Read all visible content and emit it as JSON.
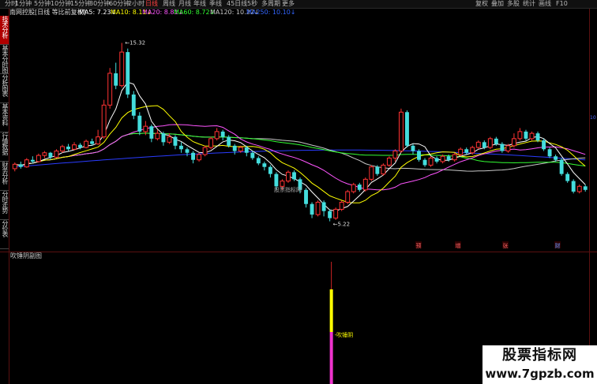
{
  "toolbar": {
    "items": [
      "分时",
      "1分钟",
      "5分钟",
      "10分钟",
      "15分钟",
      "30分钟",
      "60分钟",
      "2小时",
      "日线",
      "周线",
      "月线",
      "年线",
      "季线",
      "45日线",
      "5秒",
      "多周期",
      "更多"
    ],
    "right_items": [
      "复权",
      "叠加",
      "多股",
      "统计",
      "画线",
      "F10"
    ],
    "active": "日线"
  },
  "left_tabs": [
    "技术分析",
    "基本分时图",
    "分析图表",
    "基本资料",
    "行情数据",
    "财务分析",
    "分时走势",
    "分价表"
  ],
  "infobar": {
    "stock": "南网控股[日线 等比前复权]",
    "ma": [
      {
        "label": "MA5: 7.23",
        "color": "#ffffff",
        "arrow": "↓"
      },
      {
        "label": "MA10: 8.11",
        "color": "#ffff00",
        "arrow": "↓"
      },
      {
        "label": "MA20: 8.81",
        "color": "#ff55ff",
        "arrow": "↓"
      },
      {
        "label": "MA60: 8.72",
        "color": "#33ff33",
        "arrow": "↓"
      },
      {
        "label": "MA120: 10.22",
        "color": "#c8c8c8",
        "arrow": "↓"
      },
      {
        "label": "MA250: 10.10",
        "color": "#3366ff",
        "arrow": "↓"
      }
    ]
  },
  "subchart": {
    "title": "吹锤阴副图",
    "indicator_label": "吹锤阴"
  },
  "watermark_center": "股票指标网",
  "logo": {
    "cn": "股票指标网",
    "url": "www.7gpzb.com"
  },
  "right_value": "10",
  "events": [
    {
      "label": "预",
      "color": "#ff6666"
    },
    {
      "label": "增",
      "color": "#ff6666"
    },
    {
      "label": "张",
      "color": "#ff6666"
    },
    {
      "label": "财",
      "color": "#6699ff"
    }
  ],
  "chart_data": {
    "type": "candlestick",
    "annotations": {
      "high": "15.32",
      "low": "5.22"
    },
    "ylim": [
      4.0,
      16.5
    ],
    "up_color": "#ff3333",
    "down_color": "#44dddd",
    "candles": [
      [
        8.2,
        8.45,
        8.55,
        8.05
      ],
      [
        8.45,
        8.3,
        8.6,
        8.2
      ],
      [
        8.3,
        8.7,
        8.8,
        8.25
      ],
      [
        8.7,
        8.6,
        8.9,
        8.5
      ],
      [
        8.6,
        8.95,
        9.05,
        8.55
      ],
      [
        8.95,
        9.1,
        9.2,
        8.8
      ],
      [
        9.1,
        8.85,
        9.15,
        8.7
      ],
      [
        8.85,
        9.2,
        9.3,
        8.8
      ],
      [
        9.2,
        9.45,
        9.55,
        9.1
      ],
      [
        9.45,
        9.3,
        9.6,
        9.2
      ],
      [
        9.3,
        9.55,
        9.7,
        9.25
      ],
      [
        9.55,
        9.4,
        9.65,
        9.3
      ],
      [
        9.4,
        9.75,
        9.85,
        9.35
      ],
      [
        9.75,
        9.6,
        9.9,
        9.5
      ],
      [
        9.6,
        10.0,
        10.4,
        9.55
      ],
      [
        10.0,
        11.8,
        12.1,
        9.9
      ],
      [
        11.8,
        13.6,
        13.9,
        11.6
      ],
      [
        13.6,
        12.9,
        14.2,
        12.7
      ],
      [
        12.9,
        14.8,
        15.32,
        12.8
      ],
      [
        14.8,
        12.4,
        15.0,
        12.2
      ],
      [
        12.4,
        11.2,
        12.6,
        11.0
      ],
      [
        11.2,
        10.3,
        11.4,
        10.1
      ],
      [
        10.3,
        10.6,
        10.9,
        10.1
      ],
      [
        10.6,
        9.9,
        10.7,
        9.7
      ],
      [
        9.9,
        10.2,
        10.4,
        9.8
      ],
      [
        10.2,
        9.7,
        10.3,
        9.5
      ],
      [
        9.7,
        10.0,
        10.2,
        9.6
      ],
      [
        10.0,
        9.5,
        10.1,
        9.3
      ],
      [
        9.5,
        9.3,
        9.7,
        9.1
      ],
      [
        9.3,
        9.1,
        9.4,
        8.9
      ],
      [
        9.1,
        8.7,
        9.2,
        8.5
      ],
      [
        8.7,
        9.0,
        9.1,
        8.6
      ],
      [
        9.0,
        9.4,
        9.5,
        8.9
      ],
      [
        9.4,
        9.9,
        10.0,
        9.3
      ],
      [
        9.9,
        10.3,
        10.5,
        9.8
      ],
      [
        10.3,
        10.0,
        10.4,
        9.8
      ],
      [
        10.0,
        9.5,
        10.1,
        9.4
      ],
      [
        9.5,
        9.2,
        9.6,
        9.0
      ],
      [
        9.2,
        9.4,
        9.5,
        9.1
      ],
      [
        9.4,
        9.1,
        9.5,
        8.9
      ],
      [
        9.1,
        8.8,
        9.2,
        8.7
      ],
      [
        8.8,
        8.5,
        8.9,
        8.4
      ],
      [
        8.5,
        8.3,
        8.6,
        8.1
      ],
      [
        8.3,
        7.9,
        8.4,
        7.7
      ],
      [
        7.9,
        7.2,
        8.0,
        7.0
      ],
      [
        7.2,
        7.5,
        7.6,
        7.0
      ],
      [
        7.5,
        8.0,
        8.1,
        7.4
      ],
      [
        8.0,
        7.6,
        8.1,
        7.5
      ],
      [
        7.6,
        7.0,
        7.7,
        6.8
      ],
      [
        7.0,
        6.2,
        7.1,
        6.0
      ],
      [
        6.2,
        5.6,
        6.3,
        5.4
      ],
      [
        5.6,
        6.3,
        6.4,
        5.5
      ],
      [
        6.3,
        5.8,
        6.4,
        5.5
      ],
      [
        5.8,
        5.4,
        5.9,
        5.22
      ],
      [
        5.4,
        5.9,
        6.0,
        5.3
      ],
      [
        5.9,
        6.3,
        6.4,
        5.8
      ],
      [
        6.3,
        6.9,
        7.0,
        6.2
      ],
      [
        6.9,
        7.3,
        7.4,
        6.8
      ],
      [
        7.3,
        7.0,
        7.4,
        6.9
      ],
      [
        7.0,
        7.6,
        7.7,
        6.9
      ],
      [
        7.6,
        8.3,
        8.4,
        7.5
      ],
      [
        8.3,
        7.9,
        8.4,
        7.8
      ],
      [
        7.9,
        8.4,
        8.5,
        7.8
      ],
      [
        8.4,
        8.8,
        8.9,
        8.3
      ],
      [
        8.8,
        9.2,
        9.3,
        8.6
      ],
      [
        9.2,
        11.4,
        11.6,
        9.1
      ],
      [
        11.4,
        9.5,
        11.5,
        9.4
      ],
      [
        9.5,
        9.2,
        9.6,
        9.0
      ],
      [
        9.2,
        8.7,
        9.3,
        8.6
      ],
      [
        8.7,
        8.4,
        8.8,
        8.3
      ],
      [
        8.4,
        8.8,
        8.9,
        8.3
      ],
      [
        8.8,
        8.6,
        8.9,
        8.5
      ],
      [
        8.6,
        8.9,
        9.0,
        8.5
      ],
      [
        8.9,
        8.7,
        9.0,
        8.6
      ],
      [
        8.7,
        9.0,
        9.1,
        8.6
      ],
      [
        9.0,
        9.3,
        9.4,
        8.9
      ],
      [
        9.3,
        9.1,
        9.4,
        9.0
      ],
      [
        9.1,
        9.4,
        9.5,
        9.0
      ],
      [
        9.4,
        9.7,
        9.8,
        9.3
      ],
      [
        9.7,
        9.4,
        9.8,
        9.3
      ],
      [
        9.4,
        9.9,
        10.0,
        9.3
      ],
      [
        9.9,
        9.6,
        10.0,
        9.5
      ],
      [
        9.6,
        9.2,
        9.7,
        9.1
      ],
      [
        9.2,
        9.5,
        9.6,
        9.1
      ],
      [
        9.5,
        9.9,
        10.2,
        9.4
      ],
      [
        9.9,
        10.3,
        10.5,
        9.8
      ],
      [
        10.3,
        9.9,
        10.4,
        9.8
      ],
      [
        9.9,
        10.2,
        10.3,
        9.8
      ],
      [
        10.2,
        9.8,
        10.3,
        9.7
      ],
      [
        9.8,
        9.3,
        9.9,
        9.2
      ],
      [
        9.3,
        8.9,
        9.4,
        8.8
      ],
      [
        8.9,
        8.7,
        9.0,
        8.6
      ],
      [
        8.7,
        7.9,
        8.8,
        7.8
      ],
      [
        7.9,
        7.5,
        8.0,
        7.4
      ],
      [
        7.5,
        6.9,
        7.6,
        6.8
      ],
      [
        6.9,
        7.2,
        7.3,
        6.8
      ],
      [
        7.2,
        7.0,
        7.3,
        6.9
      ]
    ],
    "subchart_bar": {
      "yellow": [
        0,
        0.45
      ],
      "magenta": [
        0.45,
        1.0
      ]
    }
  }
}
